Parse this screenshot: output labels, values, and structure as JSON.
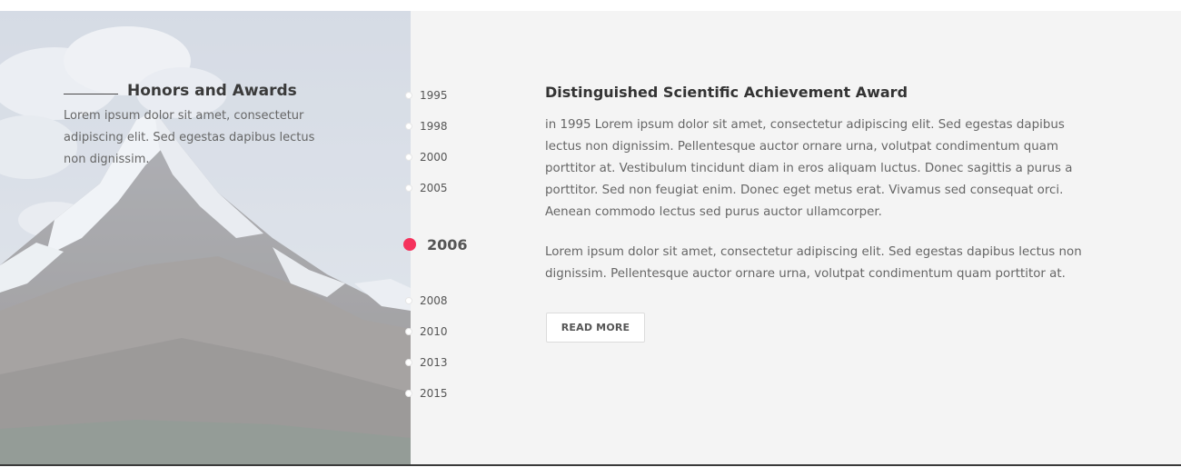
{
  "section": {
    "title": "Honors and Awards",
    "description": "Lorem ipsum dolor sit amet, consectetur adipiscing elit. Sed egestas dapibus lectus non dignissim."
  },
  "timeline": {
    "years": [
      "1995",
      "1998",
      "2000",
      "2005",
      "2006",
      "2008",
      "2010",
      "2013",
      "2015"
    ],
    "active": "2006"
  },
  "award": {
    "title": "Distinguished Scientific Achievement Award",
    "paragraph_1": "in 1995 Lorem ipsum dolor sit amet, consectetur adipiscing elit. Sed egestas dapibus lectus non dignissim. Pellentesque auctor ornare urna, volutpat condimentum quam porttitor at. Vestibulum tincidunt diam in eros aliquam luctus. Donec sagittis a purus a porttitor. Sed non feugiat enim. Donec eget metus erat. Vivamus sed consequat orci. Aenean commodo lectus sed purus auctor ullamcorper.",
    "paragraph_2": "Lorem ipsum dolor sit amet, consectetur adipiscing elit. Sed egestas dapibus lectus non dignissim. Pellentesque auctor ornare urna, volutpat condimentum quam porttitor at.",
    "read_more_label": "READ MORE"
  },
  "colors": {
    "accent": "#f5325c",
    "panel_background": "#f4f4f4"
  }
}
